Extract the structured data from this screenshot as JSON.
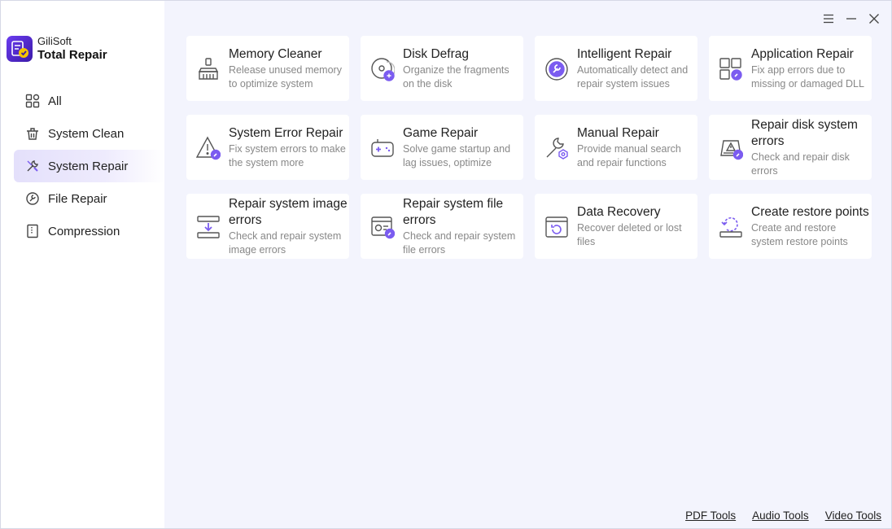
{
  "brand": {
    "company": "GiliSoft",
    "product": "Total Repair"
  },
  "colors": {
    "accent": "#7b5cf0",
    "icon": "#555555",
    "active_bg": "#e4e0fb"
  },
  "nav": {
    "items": [
      {
        "label": "All",
        "icon": "grid-icon"
      },
      {
        "label": "System Clean",
        "icon": "trash-icon"
      },
      {
        "label": "System Repair",
        "icon": "wrench-icon",
        "active": true
      },
      {
        "label": "File Repair",
        "icon": "file-repair-icon"
      },
      {
        "label": "Compression",
        "icon": "zip-icon"
      }
    ]
  },
  "cards": [
    {
      "title": "Memory Cleaner",
      "desc": "Release unused memory to optimize system",
      "icon": "broom-icon"
    },
    {
      "title": "Disk Defrag",
      "desc": "Organize the fragments on the disk",
      "icon": "disk-icon"
    },
    {
      "title": "Intelligent Repair",
      "desc": "Automatically detect and repair system issues",
      "icon": "smart-wrench-icon"
    },
    {
      "title": "Application Repair",
      "desc": "Fix app errors due to missing or damaged DLL",
      "icon": "app-grid-icon"
    },
    {
      "title": "System Error Repair",
      "desc": "Fix system errors to make the system more",
      "icon": "warning-icon"
    },
    {
      "title": "Game Repair",
      "desc": "Solve game startup and lag issues, optimize",
      "icon": "gamepad-icon"
    },
    {
      "title": "Manual Repair",
      "desc": "Provide manual search and repair functions",
      "icon": "manual-wrench-icon"
    },
    {
      "title": "Repair disk system errors",
      "desc": "Check and repair disk errors",
      "icon": "disk-warning-icon"
    },
    {
      "title": "Repair system image errors",
      "desc": "Check and repair system image errors",
      "icon": "image-download-icon"
    },
    {
      "title": "Repair system file errors",
      "desc": "Check and repair system file errors",
      "icon": "file-gear-icon"
    },
    {
      "title": "Data Recovery",
      "desc": "Recover deleted or lost files",
      "icon": "recovery-icon"
    },
    {
      "title": "Create restore points",
      "desc": "Create and restore system restore points",
      "icon": "restore-icon"
    }
  ],
  "footer": {
    "pdf": "PDF Tools",
    "audio": "Audio Tools",
    "video": "Video Tools"
  }
}
